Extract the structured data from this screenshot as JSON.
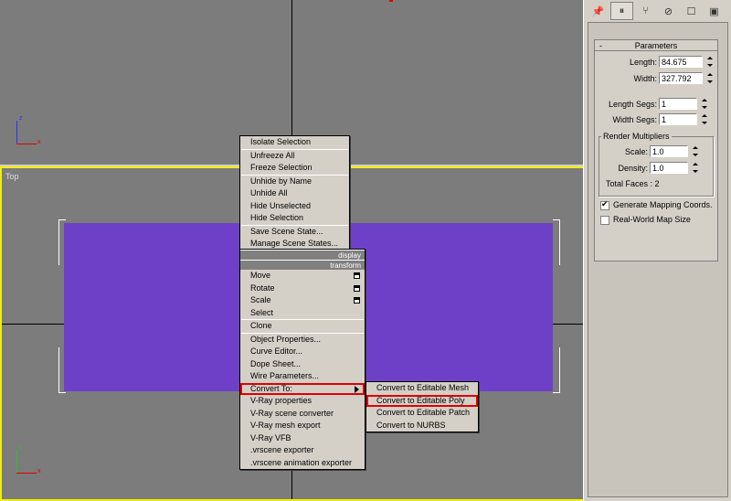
{
  "viewports": {
    "bottom_label": "Top",
    "axis_x": "x",
    "axis_z": "z",
    "axis_y": "y"
  },
  "context_menu": {
    "display_items": [
      "Isolate Selection",
      "Unfreeze All",
      "Freeze Selection",
      "Unhide by Name",
      "Unhide All",
      "Hide Unselected",
      "Hide Selection",
      "Save Scene State...",
      "Manage Scene States..."
    ],
    "display_header": "display",
    "transform_header": "transform",
    "transform_items": [
      "Move",
      "Rotate",
      "Scale",
      "Select",
      "Clone",
      "Object Properties...",
      "Curve Editor...",
      "Dope Sheet...",
      "Wire Parameters...",
      "Convert To:",
      "V-Ray properties",
      "V-Ray scene converter",
      "V-Ray mesh export",
      "V-Ray VFB",
      ".vrscene exporter",
      ".vrscene animation exporter"
    ]
  },
  "convert_submenu": [
    "Convert to Editable Mesh",
    "Convert to Editable Poly",
    "Convert to Editable Patch",
    "Convert to NURBS"
  ],
  "panel": {
    "tab_icons": [
      "pin-icon",
      "modify-icon",
      "hierarchy-icon",
      "motion-icon",
      "display-icon",
      "utilities-icon"
    ],
    "rollout_title": "Parameters",
    "rollout_toggle": "-",
    "length_label": "Length:",
    "length_value": "84.675",
    "width_label": "Width:",
    "width_value": "327.792",
    "length_segs_label": "Length Segs:",
    "length_segs_value": "1",
    "width_segs_label": "Width Segs:",
    "width_segs_value": "1",
    "render_group": "Render Multipliers",
    "scale_label": "Scale:",
    "scale_value": "1.0",
    "density_label": "Density:",
    "density_value": "1.0",
    "total_faces": "Total Faces : 2",
    "gen_mapping": "Generate Mapping Coords.",
    "real_world": "Real-World Map Size"
  }
}
